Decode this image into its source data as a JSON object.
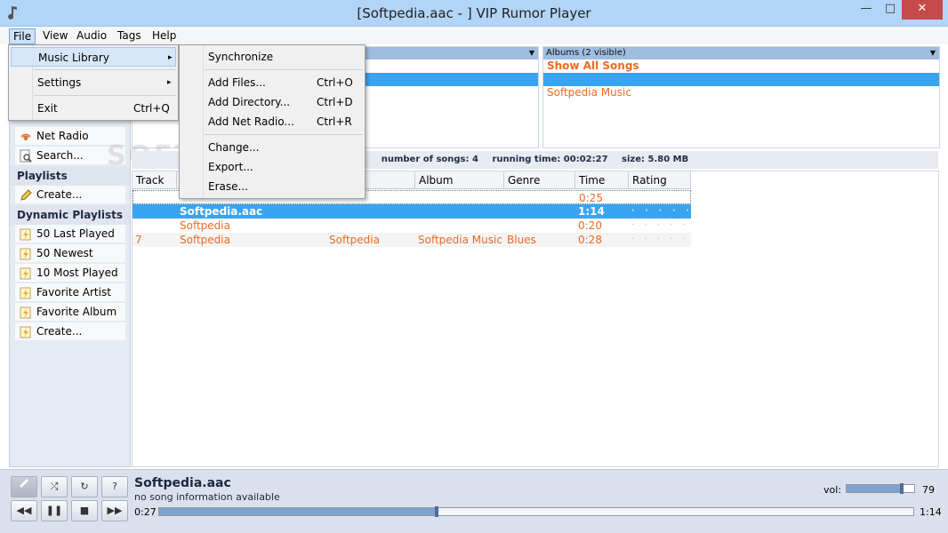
{
  "window": {
    "title": "[Softpedia.aac - ] VIP Rumor Player",
    "min": "—",
    "max": "□",
    "close": "✕"
  },
  "menubar": [
    "File",
    "View",
    "Audio",
    "Tags",
    "Help"
  ],
  "file_menu": {
    "music_library": "Music Library",
    "settings": "Settings",
    "exit": "Exit",
    "exit_shortcut": "Ctrl+Q",
    "arrow": "▸"
  },
  "library_menu": {
    "synchronize": "Synchronize",
    "add_files": "Add Files...",
    "add_files_sc": "Ctrl+O",
    "add_directory": "Add Directory...",
    "add_directory_sc": "Ctrl+D",
    "add_net_radio": "Add Net Radio...",
    "add_net_radio_sc": "Ctrl+R",
    "change": "Change...",
    "export": "Export...",
    "erase": "Erase..."
  },
  "sidebar": {
    "net_radio": "Net Radio",
    "search": "Search...",
    "playlists_header": "Playlists",
    "playlists_create": "Create...",
    "dynamic_header": "Dynamic Playlists",
    "dynamic": [
      "50 Last Played",
      "50 Newest",
      "10 Most Played",
      "Favorite Artist",
      "Favorite Album"
    ],
    "dynamic_create": "Create..."
  },
  "albums_pane": {
    "header": "Albums (2 visible)",
    "show_all": "Show All Songs",
    "albums": [
      "Softpedia Music"
    ]
  },
  "stats": {
    "songs": "number of songs: 4",
    "running_time": "running time: 00:02:27",
    "size": "size: 5.80 MB"
  },
  "table": {
    "columns": [
      "Track",
      "Album",
      "Genre",
      "Time",
      "Rating"
    ],
    "rows": [
      {
        "track": "",
        "title": "",
        "artist": "",
        "album": "",
        "genre": "",
        "time": "0:25",
        "rating": ""
      },
      {
        "track": "",
        "title": "Softpedia.aac",
        "artist": "",
        "album": "",
        "genre": "",
        "time": "1:14",
        "rating": "· · · · ·"
      },
      {
        "track": "",
        "title": "Softpedia",
        "artist": "",
        "album": "",
        "genre": "",
        "time": "0:20",
        "rating": "· · · · ·"
      },
      {
        "track": "7",
        "title": "Softpedia",
        "artist": "Softpedia",
        "album": "Softpedia Music",
        "genre": "Blues",
        "time": "0:28",
        "rating": "· · · · ·"
      }
    ]
  },
  "player": {
    "title": "Softpedia.aac",
    "info": "no song information available",
    "elapsed": "0:27",
    "duration": "1:14",
    "progress_fraction": 0.365,
    "volume_label": "vol:",
    "volume": 79
  },
  "watermark": "SOFTPEDIA",
  "colors": {
    "accent": "#39a4f0",
    "link_orange": "#ee6b21",
    "titlebar": "#b2d4f7"
  }
}
